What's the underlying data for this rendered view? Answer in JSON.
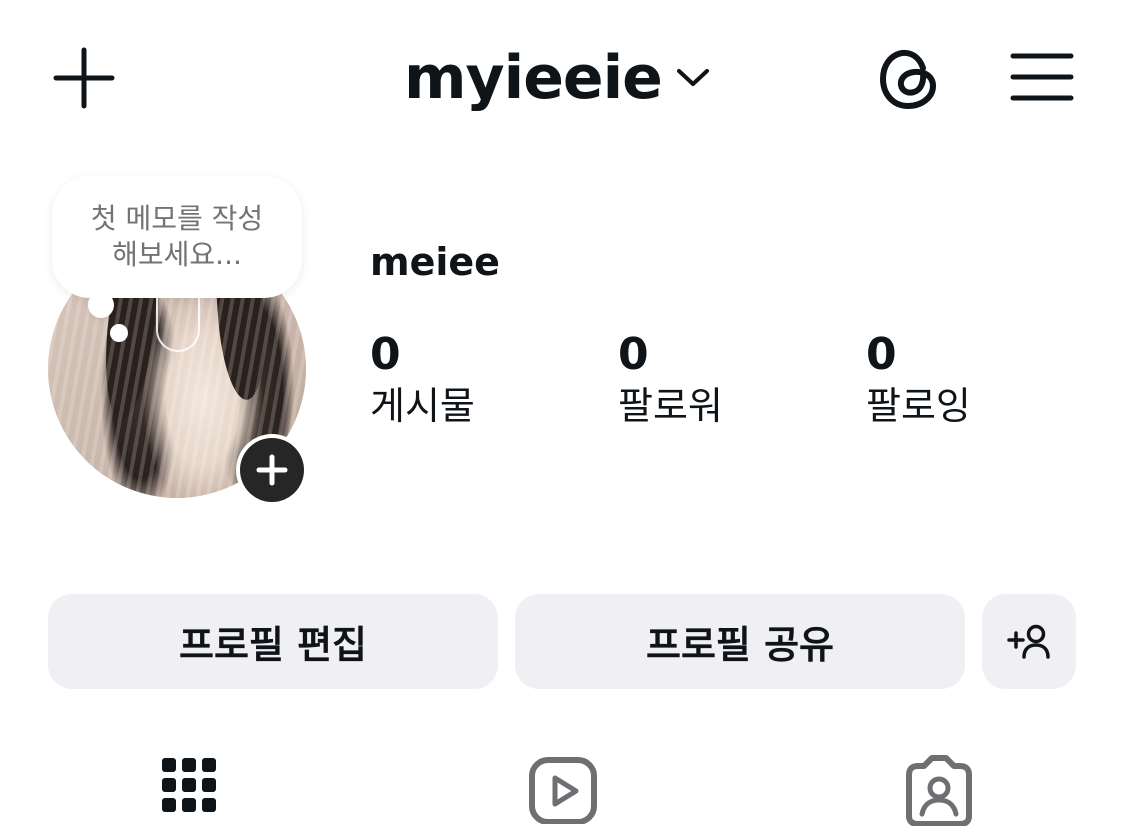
{
  "header": {
    "username": "myieeie",
    "create_icon": "plus-icon",
    "switcher_icon": "chevron-down-icon",
    "threads_icon": "threads-icon",
    "menu_icon": "hamburger-menu-icon"
  },
  "note": {
    "text": "첫 메모를 작성\n해보세요..."
  },
  "profile": {
    "display_name": "meiee",
    "stats": [
      {
        "count": "0",
        "label": "게시물"
      },
      {
        "count": "0",
        "label": "팔로워"
      },
      {
        "count": "0",
        "label": "팔로잉"
      }
    ]
  },
  "actions": {
    "edit_label": "프로필 편집",
    "share_label": "프로필 공유",
    "discover_icon": "add-person-icon"
  },
  "tabs": [
    {
      "icon": "grid-icon"
    },
    {
      "icon": "reels-icon"
    },
    {
      "icon": "tagged-icon"
    }
  ]
}
